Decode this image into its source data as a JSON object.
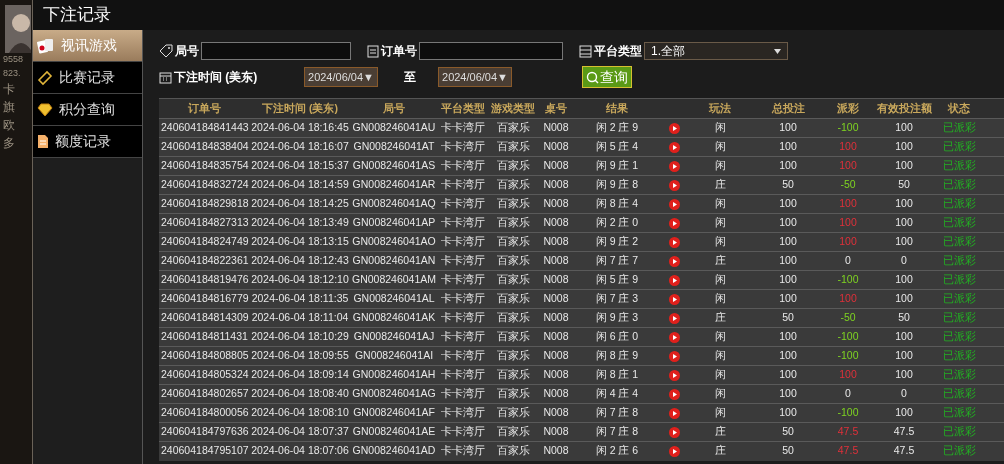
{
  "background": {
    "texts": [
      "9558",
      "823.",
      "卡",
      "旗",
      "欧",
      "多"
    ]
  },
  "window": {
    "title": "下注记录"
  },
  "nav": [
    {
      "label": "视讯游戏",
      "kind": "cards",
      "selected": true
    },
    {
      "label": "比赛记录",
      "kind": "ticket",
      "selected": false
    },
    {
      "label": "积分查询",
      "kind": "diamond",
      "selected": false
    },
    {
      "label": "额度记录",
      "kind": "doc",
      "selected": false
    }
  ],
  "filters": {
    "round_label": "局号",
    "order_label": "订单号",
    "platform_label": "平台类型",
    "platform_value": "1.全部",
    "time_label": "下注时间 (美东)",
    "date_from": "2024/06/04▼",
    "to_label": "至",
    "date_to": "2024/06/04▼",
    "query_button": "查询"
  },
  "table": {
    "columns": [
      "订单号",
      "下注时间 (美东)",
      "局号",
      "平台类型",
      "游戏类型",
      "桌号",
      "结果",
      "",
      "玩法",
      "总投注",
      "派彩",
      "有效投注额",
      "状态"
    ],
    "rows": [
      {
        "order": "240604184841443",
        "time": "2024-06-04 18:16:45",
        "round": "GN008246041AU",
        "platform": "卡卡湾厅",
        "game": "百家乐",
        "table": "N008",
        "result": "闲 2 庄 9",
        "play": "闲",
        "bet": "100",
        "payout": "-100",
        "kind": "loss",
        "valid": "100",
        "status": "已派彩"
      },
      {
        "order": "240604184838404",
        "time": "2024-06-04 18:16:07",
        "round": "GN008246041AT",
        "platform": "卡卡湾厅",
        "game": "百家乐",
        "table": "N008",
        "result": "闲 5 庄 4",
        "play": "闲",
        "bet": "100",
        "payout": "100",
        "kind": "win",
        "valid": "100",
        "status": "已派彩"
      },
      {
        "order": "240604184835754",
        "time": "2024-06-04 18:15:37",
        "round": "GN008246041AS",
        "platform": "卡卡湾厅",
        "game": "百家乐",
        "table": "N008",
        "result": "闲 9 庄 1",
        "play": "闲",
        "bet": "100",
        "payout": "100",
        "kind": "win",
        "valid": "100",
        "status": "已派彩"
      },
      {
        "order": "240604184832724",
        "time": "2024-06-04 18:14:59",
        "round": "GN008246041AR",
        "platform": "卡卡湾厅",
        "game": "百家乐",
        "table": "N008",
        "result": "闲 9 庄 8",
        "play": "庄",
        "bet": "50",
        "payout": "-50",
        "kind": "loss",
        "valid": "50",
        "status": "已派彩"
      },
      {
        "order": "240604184829818",
        "time": "2024-06-04 18:14:25",
        "round": "GN008246041AQ",
        "platform": "卡卡湾厅",
        "game": "百家乐",
        "table": "N008",
        "result": "闲 8 庄 4",
        "play": "闲",
        "bet": "100",
        "payout": "100",
        "kind": "win",
        "valid": "100",
        "status": "已派彩"
      },
      {
        "order": "240604184827313",
        "time": "2024-06-04 18:13:49",
        "round": "GN008246041AP",
        "platform": "卡卡湾厅",
        "game": "百家乐",
        "table": "N008",
        "result": "闲 2 庄 0",
        "play": "闲",
        "bet": "100",
        "payout": "100",
        "kind": "win",
        "valid": "100",
        "status": "已派彩"
      },
      {
        "order": "240604184824749",
        "time": "2024-06-04 18:13:15",
        "round": "GN008246041AO",
        "platform": "卡卡湾厅",
        "game": "百家乐",
        "table": "N008",
        "result": "闲 9 庄 2",
        "play": "闲",
        "bet": "100",
        "payout": "100",
        "kind": "win",
        "valid": "100",
        "status": "已派彩"
      },
      {
        "order": "240604184822361",
        "time": "2024-06-04 18:12:43",
        "round": "GN008246041AN",
        "platform": "卡卡湾厅",
        "game": "百家乐",
        "table": "N008",
        "result": "闲 7 庄 7",
        "play": "庄",
        "bet": "100",
        "payout": "0",
        "kind": "zero",
        "valid": "0",
        "status": "已派彩"
      },
      {
        "order": "240604184819476",
        "time": "2024-06-04 18:12:10",
        "round": "GN008246041AM",
        "platform": "卡卡湾厅",
        "game": "百家乐",
        "table": "N008",
        "result": "闲 5 庄 9",
        "play": "闲",
        "bet": "100",
        "payout": "-100",
        "kind": "loss",
        "valid": "100",
        "status": "已派彩"
      },
      {
        "order": "240604184816779",
        "time": "2024-06-04 18:11:35",
        "round": "GN008246041AL",
        "platform": "卡卡湾厅",
        "game": "百家乐",
        "table": "N008",
        "result": "闲 7 庄 3",
        "play": "闲",
        "bet": "100",
        "payout": "100",
        "kind": "win",
        "valid": "100",
        "status": "已派彩"
      },
      {
        "order": "240604184814309",
        "time": "2024-06-04 18:11:04",
        "round": "GN008246041AK",
        "platform": "卡卡湾厅",
        "game": "百家乐",
        "table": "N008",
        "result": "闲 9 庄 3",
        "play": "庄",
        "bet": "50",
        "payout": "-50",
        "kind": "loss",
        "valid": "50",
        "status": "已派彩"
      },
      {
        "order": "240604184811431",
        "time": "2024-06-04 18:10:29",
        "round": "GN008246041AJ",
        "platform": "卡卡湾厅",
        "game": "百家乐",
        "table": "N008",
        "result": "闲 6 庄 0",
        "play": "闲",
        "bet": "100",
        "payout": "-100",
        "kind": "loss",
        "valid": "100",
        "status": "已派彩"
      },
      {
        "order": "240604184808805",
        "time": "2024-06-04 18:09:55",
        "round": "GN008246041AI",
        "platform": "卡卡湾厅",
        "game": "百家乐",
        "table": "N008",
        "result": "闲 8 庄 9",
        "play": "闲",
        "bet": "100",
        "payout": "-100",
        "kind": "loss",
        "valid": "100",
        "status": "已派彩"
      },
      {
        "order": "240604184805324",
        "time": "2024-06-04 18:09:14",
        "round": "GN008246041AH",
        "platform": "卡卡湾厅",
        "game": "百家乐",
        "table": "N008",
        "result": "闲 8 庄 1",
        "play": "闲",
        "bet": "100",
        "payout": "100",
        "kind": "win",
        "valid": "100",
        "status": "已派彩"
      },
      {
        "order": "240604184802657",
        "time": "2024-06-04 18:08:40",
        "round": "GN008246041AG",
        "platform": "卡卡湾厅",
        "game": "百家乐",
        "table": "N008",
        "result": "闲 4 庄 4",
        "play": "闲",
        "bet": "100",
        "payout": "0",
        "kind": "zero",
        "valid": "0",
        "status": "已派彩"
      },
      {
        "order": "240604184800056",
        "time": "2024-06-04 18:08:10",
        "round": "GN008246041AF",
        "platform": "卡卡湾厅",
        "game": "百家乐",
        "table": "N008",
        "result": "闲 7 庄 8",
        "play": "闲",
        "bet": "100",
        "payout": "-100",
        "kind": "loss",
        "valid": "100",
        "status": "已派彩"
      },
      {
        "order": "240604184797636",
        "time": "2024-06-04 18:07:37",
        "round": "GN008246041AE",
        "platform": "卡卡湾厅",
        "game": "百家乐",
        "table": "N008",
        "result": "闲 7 庄 8",
        "play": "庄",
        "bet": "50",
        "payout": "47.5",
        "kind": "win",
        "valid": "47.5",
        "status": "已派彩"
      },
      {
        "order": "240604184795107",
        "time": "2024-06-04 18:07:06",
        "round": "GN008246041AD",
        "platform": "卡卡湾厅",
        "game": "百家乐",
        "table": "N008",
        "result": "闲 2 庄 6",
        "play": "庄",
        "bet": "50",
        "payout": "47.5",
        "kind": "win",
        "valid": "47.5",
        "status": "已派彩"
      }
    ]
  }
}
